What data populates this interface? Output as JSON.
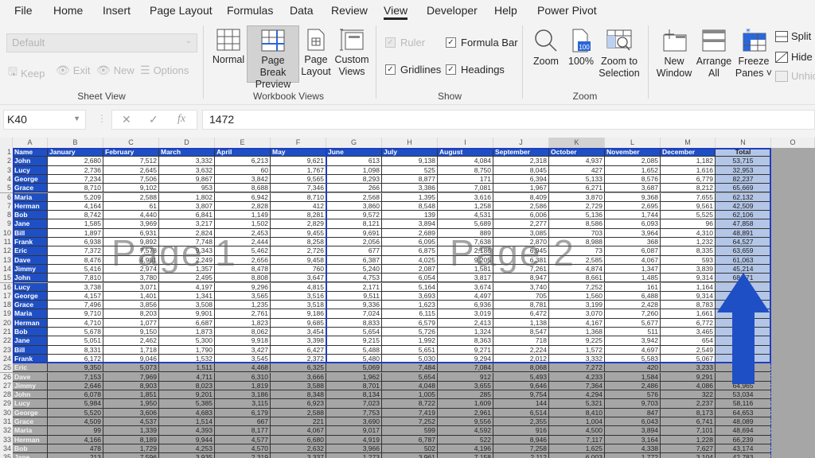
{
  "ribbon": {
    "tabs": [
      "File",
      "Home",
      "Insert",
      "Page Layout",
      "Formulas",
      "Data",
      "Review",
      "View",
      "Developer",
      "Help",
      "Power Pivot"
    ],
    "active_tab": "View",
    "sheet_view": {
      "select_value": "Default",
      "buttons": [
        "Keep",
        "Exit",
        "New",
        "Options"
      ],
      "group_label": "Sheet View"
    },
    "workbook_views": {
      "buttons": [
        {
          "label_line1": "Normal",
          "label_line2": ""
        },
        {
          "label_line1": "Page Break",
          "label_line2": "Preview"
        },
        {
          "label_line1": "Page",
          "label_line2": "Layout"
        },
        {
          "label_line1": "Custom",
          "label_line2": "Views"
        }
      ],
      "group_label": "Workbook Views"
    },
    "show": {
      "ruler": {
        "label": "Ruler",
        "checked": true,
        "enabled": false
      },
      "formula_bar": {
        "label": "Formula Bar",
        "checked": true
      },
      "gridlines": {
        "label": "Gridlines",
        "checked": true
      },
      "headings": {
        "label": "Headings",
        "checked": true
      },
      "group_label": "Show"
    },
    "zoom": {
      "buttons": [
        {
          "label_line1": "Zoom",
          "label_line2": ""
        },
        {
          "label_line1": "100%",
          "label_line2": ""
        },
        {
          "label_line1": "Zoom to",
          "label_line2": "Selection"
        }
      ],
      "icon_100_text": "100",
      "group_label": "Zoom"
    },
    "window": {
      "buttons": [
        {
          "label_line1": "New",
          "label_line2": "Window"
        },
        {
          "label_line1": "Arrange",
          "label_line2": "All"
        },
        {
          "label_line1": "Freeze",
          "label_line2": "Panes ˅"
        }
      ],
      "split": "Split",
      "hide": "Hide",
      "unhide": "Unhide"
    }
  },
  "formula_bar": {
    "name_box": "K40",
    "cancel": "✕",
    "enter": "✓",
    "fx": "fx",
    "value": "1472"
  },
  "sheet": {
    "columns": [
      "A",
      "B",
      "C",
      "D",
      "E",
      "F",
      "G",
      "H",
      "I",
      "J",
      "K",
      "L",
      "M",
      "N",
      "O"
    ],
    "selected_column": "K",
    "headers": [
      "Name",
      "January",
      "February",
      "March",
      "April",
      "May",
      "June",
      "July",
      "August",
      "September",
      "October",
      "November",
      "December",
      "Total"
    ],
    "rows": [
      [
        "John",
        "2,680",
        "7,512",
        "3,332",
        "6,213",
        "9,621",
        "613",
        "9,138",
        "4,084",
        "2,318",
        "4,937",
        "2,085",
        "1,182",
        "53,715"
      ],
      [
        "Lucy",
        "2,736",
        "2,645",
        "3,632",
        "60",
        "1,767",
        "1,098",
        "525",
        "8,750",
        "8,045",
        "427",
        "1,652",
        "1,616",
        "32,953"
      ],
      [
        "George",
        "7,234",
        "7,506",
        "9,867",
        "3,842",
        "9,565",
        "8,293",
        "8,877",
        "171",
        "6,394",
        "5,133",
        "8,576",
        "6,779",
        "82,237"
      ],
      [
        "Grace",
        "8,710",
        "9,102",
        "953",
        "8,688",
        "7,346",
        "266",
        "3,386",
        "7,081",
        "1,967",
        "6,271",
        "3,687",
        "8,212",
        "65,669"
      ],
      [
        "Maria",
        "5,209",
        "2,588",
        "1,802",
        "6,942",
        "8,710",
        "2,568",
        "1,395",
        "3,616",
        "8,409",
        "3,870",
        "9,368",
        "7,655",
        "62,132"
      ],
      [
        "Herman",
        "4,164",
        "61",
        "3,807",
        "2,828",
        "412",
        "3,860",
        "8,548",
        "1,258",
        "2,586",
        "2,729",
        "2,695",
        "9,561",
        "42,509"
      ],
      [
        "Bob",
        "8,742",
        "4,440",
        "6,841",
        "1,149",
        "8,281",
        "9,572",
        "139",
        "4,531",
        "6,006",
        "5,136",
        "1,744",
        "5,525",
        "62,106"
      ],
      [
        "Jane",
        "1,585",
        "3,969",
        "3,217",
        "1,502",
        "2,829",
        "8,121",
        "3,894",
        "5,689",
        "2,277",
        "8,586",
        "6,093",
        "96",
        "47,858"
      ],
      [
        "Bill",
        "1,897",
        "6,931",
        "2,824",
        "2,453",
        "9,455",
        "9,691",
        "2,689",
        "889",
        "3,085",
        "703",
        "3,964",
        "4,310",
        "48,891"
      ],
      [
        "Frank",
        "6,938",
        "9,892",
        "7,748",
        "2,444",
        "8,258",
        "2,056",
        "6,095",
        "7,638",
        "2,870",
        "8,988",
        "368",
        "1,232",
        "64,527"
      ],
      [
        "Eric",
        "7,372",
        "7,578",
        "9,343",
        "5,462",
        "2,726",
        "677",
        "6,875",
        "2,186",
        "6,945",
        "73",
        "6,087",
        "8,335",
        "63,659"
      ],
      [
        "Dave",
        "8,476",
        "4,981",
        "2,249",
        "2,656",
        "9,458",
        "6,387",
        "4,025",
        "9,205",
        "6,381",
        "2,585",
        "4,067",
        "593",
        "61,063"
      ],
      [
        "Jimmy",
        "5,416",
        "2,974",
        "1,357",
        "8,478",
        "760",
        "5,240",
        "2,087",
        "1,581",
        "7,261",
        "4,874",
        "1,347",
        "3,839",
        "45,214"
      ],
      [
        "John",
        "7,810",
        "3,780",
        "2,495",
        "8,808",
        "3,647",
        "4,753",
        "6,054",
        "3,817",
        "8,947",
        "8,661",
        "1,485",
        "9,314",
        "68,571"
      ],
      [
        "Lucy",
        "3,738",
        "3,071",
        "4,197",
        "9,296",
        "4,815",
        "2,171",
        "5,164",
        "3,674",
        "3,740",
        "7,252",
        "161",
        "1,164",
        ""
      ],
      [
        "George",
        "4,157",
        "1,401",
        "1,341",
        "3,565",
        "3,516",
        "9,511",
        "3,693",
        "4,497",
        "705",
        "1,560",
        "6,488",
        "9,314",
        ""
      ],
      [
        "Grace",
        "7,496",
        "3,856",
        "3,508",
        "1,235",
        "3,518",
        "9,336",
        "1,623",
        "6,936",
        "8,781",
        "3,199",
        "2,428",
        "8,783",
        ""
      ],
      [
        "Maria",
        "9,710",
        "8,203",
        "9,901",
        "2,761",
        "9,186",
        "7,024",
        "6,115",
        "3,019",
        "6,472",
        "3,070",
        "7,260",
        "1,661",
        ""
      ],
      [
        "Herman",
        "4,710",
        "1,077",
        "6,687",
        "1,823",
        "9,685",
        "8,833",
        "6,579",
        "2,413",
        "1,138",
        "4,167",
        "5,677",
        "6,772",
        ""
      ],
      [
        "Bob",
        "5,678",
        "9,150",
        "1,873",
        "8,062",
        "3,454",
        "5,654",
        "5,726",
        "1,324",
        "8,547",
        "1,368",
        "511",
        "3,465",
        ""
      ],
      [
        "Jane",
        "5,051",
        "2,462",
        "5,300",
        "9,918",
        "3,398",
        "9,215",
        "1,992",
        "8,363",
        "718",
        "9,225",
        "3,942",
        "654",
        ""
      ],
      [
        "Bill",
        "8,331",
        "1,718",
        "1,790",
        "3,427",
        "6,427",
        "5,488",
        "5,651",
        "9,271",
        "2,224",
        "1,572",
        "4,697",
        "2,549",
        ""
      ],
      [
        "Frank",
        "6,172",
        "9,046",
        "1,532",
        "3,545",
        "2,372",
        "5,480",
        "5,030",
        "9,294",
        "2,012",
        "3,332",
        "5,583",
        "5,067",
        ""
      ],
      [
        "Eric",
        "9,350",
        "5,073",
        "1,511",
        "4,468",
        "6,325",
        "5,069",
        "7,484",
        "7,084",
        "8,068",
        "7,272",
        "420",
        "3,233",
        ""
      ],
      [
        "Dave",
        "7,153",
        "7,969",
        "4,711",
        "6,310",
        "3,666",
        "1,962",
        "5,654",
        "912",
        "5,493",
        "4,233",
        "1,584",
        "9,291",
        ""
      ],
      [
        "Jimmy",
        "2,646",
        "8,903",
        "8,023",
        "1,819",
        "3,588",
        "8,701",
        "4,048",
        "3,655",
        "9,646",
        "7,364",
        "2,486",
        "4,086",
        "64,965"
      ],
      [
        "John",
        "6,078",
        "1,851",
        "9,201",
        "3,186",
        "8,348",
        "8,134",
        "1,005",
        "285",
        "9,754",
        "4,294",
        "576",
        "322",
        "53,034"
      ],
      [
        "Lucy",
        "5,984",
        "1,950",
        "5,385",
        "3,115",
        "6,923",
        "7,023",
        "8,722",
        "1,609",
        "144",
        "5,321",
        "9,703",
        "2,237",
        "58,116"
      ],
      [
        "George",
        "5,520",
        "3,606",
        "4,683",
        "6,179",
        "2,588",
        "7,753",
        "7,419",
        "2,961",
        "6,514",
        "8,410",
        "847",
        "8,173",
        "64,653"
      ],
      [
        "Grace",
        "4,509",
        "4,537",
        "1,514",
        "667",
        "221",
        "3,690",
        "7,252",
        "9,556",
        "2,355",
        "1,004",
        "6,043",
        "6,741",
        "48,089"
      ],
      [
        "Maria",
        "99",
        "1,339",
        "4,393",
        "8,177",
        "4,067",
        "9,017",
        "599",
        "4,592",
        "916",
        "4,500",
        "3,894",
        "7,101",
        "48,694"
      ],
      [
        "Herman",
        "4,166",
        "8,189",
        "9,944",
        "4,577",
        "6,680",
        "4,919",
        "6,787",
        "522",
        "8,946",
        "7,117",
        "3,164",
        "1,228",
        "66,239"
      ],
      [
        "Bob",
        "478",
        "1,729",
        "4,253",
        "4,570",
        "2,632",
        "3,966",
        "502",
        "4,196",
        "7,258",
        "1,625",
        "4,338",
        "7,627",
        "43,174"
      ],
      [
        "Jane",
        "213",
        "7,596",
        "3,935",
        "2,319",
        "3,337",
        "1,273",
        "3,961",
        "7,158",
        "2,112",
        "6,003",
        "1,772",
        "3,104",
        "42,783"
      ]
    ],
    "page_labels": [
      "Page 1",
      "Page 2"
    ],
    "colors": {
      "header_fill": "#1f4fc4",
      "total_fill": "#b4c6e7",
      "page_break_line": "#1f3fbf",
      "outside_print_area": "#a6a6a6",
      "arrow": "#1f4fc4"
    }
  }
}
